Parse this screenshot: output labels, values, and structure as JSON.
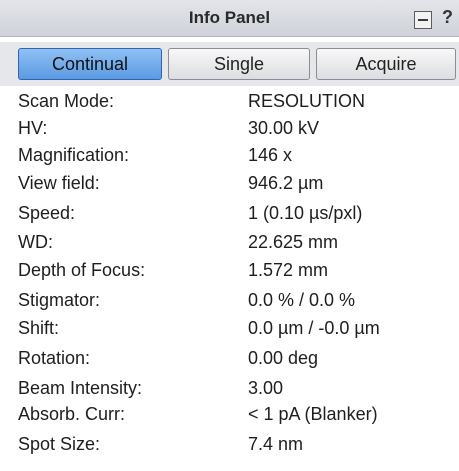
{
  "window": {
    "title": "Info Panel",
    "minimize_icon": "minimize-icon",
    "help_label": "?"
  },
  "scan_buttons": {
    "continual": "Continual",
    "single": "Single",
    "acquire": "Acquire",
    "active": "Continual"
  },
  "info_rows": [
    {
      "label": "Scan Mode:",
      "value": "RESOLUTION"
    },
    {
      "label": "HV:",
      "value": "30.00 kV"
    },
    {
      "label": "Magnification:",
      "value": "146 x"
    },
    {
      "label": "View field:",
      "value": "946.2 µm"
    },
    {
      "label": "Speed:",
      "value": "1 (0.10 µs/pxl)"
    },
    {
      "label": "WD:",
      "value": "22.625 mm"
    },
    {
      "label": "Depth of Focus:",
      "value": "1.572 mm"
    },
    {
      "label": "Stigmator:",
      "value": "0.0 % / 0.0 %"
    },
    {
      "label": "Shift:",
      "value": "0.0 µm / -0.0 µm"
    },
    {
      "label": "Rotation:",
      "value": "0.00 deg"
    },
    {
      "label": "Beam Intensity:",
      "value": "3.00"
    },
    {
      "label": "Absorb. Curr:",
      "value": "< 1 pA (Blanker)"
    },
    {
      "label": "Spot Size:",
      "value": "7.4 nm"
    }
  ],
  "colors": {
    "active_button": "#6ea8e9",
    "title_bar": "#d8dbe1"
  }
}
